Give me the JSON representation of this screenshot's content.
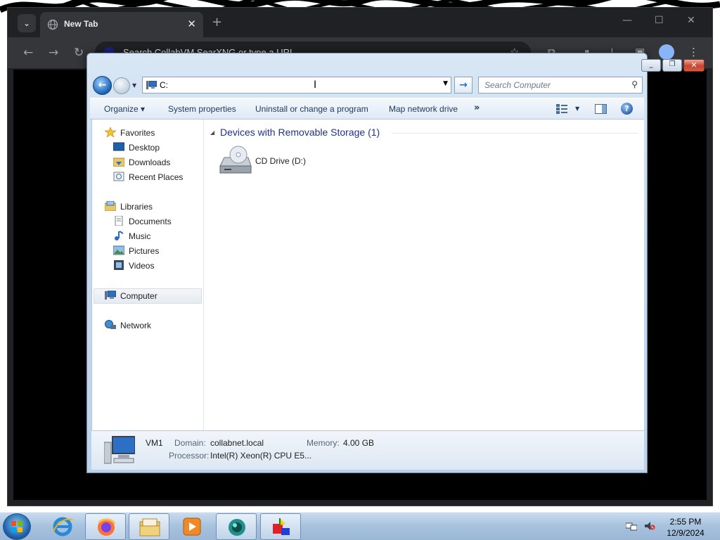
{
  "browser": {
    "tab_title": "New Tab",
    "omnibox_placeholder": "Search CollabVM SearXNG or type a URL",
    "new_tab_symbol": "+",
    "minimize_symbol": "—",
    "maximize_symbol": "☐",
    "close_symbol": "✕"
  },
  "explorer": {
    "address_value": "C:",
    "search_placeholder": "Search Computer",
    "toolbar": {
      "organize": "Organize ▾",
      "system_properties": "System properties",
      "uninstall": "Uninstall or change a program",
      "map_drive": "Map network drive",
      "more": "»"
    },
    "nav_pane": {
      "favorites": "Favorites",
      "desktop": "Desktop",
      "downloads": "Downloads",
      "recent": "Recent Places",
      "libraries": "Libraries",
      "documents": "Documents",
      "music": "Music",
      "pictures": "Pictures",
      "videos": "Videos",
      "computer": "Computer",
      "network": "Network"
    },
    "group_header": "Devices with Removable Storage (1)",
    "drives": [
      {
        "label": "CD Drive (D:)",
        "icon": "cd-drive-icon"
      }
    ],
    "details": {
      "name": "VM1",
      "domain_label": "Domain:",
      "domain_value": "collabnet.local",
      "memory_label": "Memory:",
      "memory_value": "4.00 GB",
      "processor_label": "Processor:",
      "processor_value": "Intel(R) Xeon(R) CPU E5..."
    }
  },
  "taskbar": {
    "time": "2:55 PM",
    "date": "12/9/2024",
    "pinned": [
      "internet-explorer-icon",
      "firefox-icon",
      "file-explorer-icon",
      "media-player-icon",
      "collabvm-icon",
      "app-icon"
    ]
  },
  "colors": {
    "chrome_bg": "#202124",
    "explorer_frame": "#c6d9ee",
    "link_blue": "#1e3287",
    "close_red": "#c8432f"
  }
}
